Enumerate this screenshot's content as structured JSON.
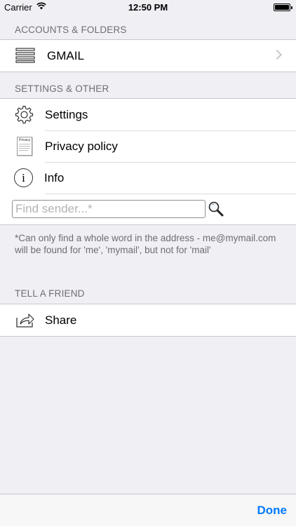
{
  "status_bar": {
    "carrier": "Carrier",
    "time": "12:50 PM"
  },
  "accounts": {
    "header": "ACCOUNTS & FOLDERS",
    "items": [
      {
        "label": "GMAIL",
        "icon": "hamburger-list-icon"
      }
    ]
  },
  "settings": {
    "header": "SETTINGS & OTHER",
    "items": [
      {
        "label": "Settings",
        "icon": "gear-icon"
      },
      {
        "label": "Privacy policy",
        "icon": "document-icon",
        "icon_text": "Privacy"
      },
      {
        "label": "Info",
        "icon": "info-icon",
        "icon_text": "i"
      }
    ],
    "search": {
      "placeholder": "Find sender...*",
      "value": "",
      "icon": "magnifier-icon"
    }
  },
  "note": "*Can only find a whole word in the address - me@mymail.com will be found for 'me', 'mymail', but not for 'mail'",
  "friend": {
    "header": "TELL A FRIEND",
    "items": [
      {
        "label": "Share",
        "icon": "share-icon"
      }
    ]
  },
  "toolbar": {
    "done_label": "Done"
  },
  "colors": {
    "accent": "#007aff",
    "background": "#efeff4",
    "header_text": "#6d6d72"
  }
}
